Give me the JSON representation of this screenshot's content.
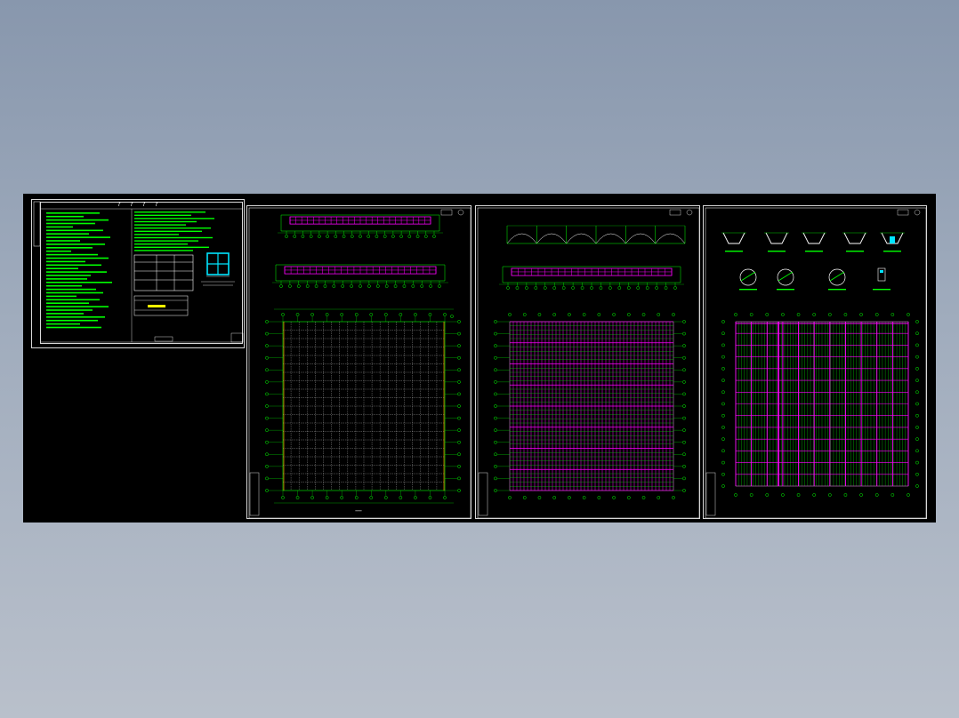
{
  "viewer": {
    "background_top": "#8897ad",
    "background_bottom": "#b9c0cb",
    "canvas_color": "#000000"
  },
  "colors": {
    "annotation": "#00ff00",
    "roof_structure": "#ff00ff",
    "grid_lines": "#ffffff",
    "axis_bubbles": "#00ff00",
    "accent_edge": "#ff8c00",
    "window_cyan": "#00e5ff",
    "sheet_border": "#d8d8d8"
  },
  "sheets": [
    {
      "id": "notes",
      "kind": "design-notes-and-schedule",
      "title_glyphs": "? ? ? ?"
    },
    {
      "id": "plan-1",
      "kind": "column-grid-plan"
    },
    {
      "id": "plan-2",
      "kind": "roof-framing-plan"
    },
    {
      "id": "plan-3",
      "kind": "purlin-layout-and-details"
    }
  ]
}
